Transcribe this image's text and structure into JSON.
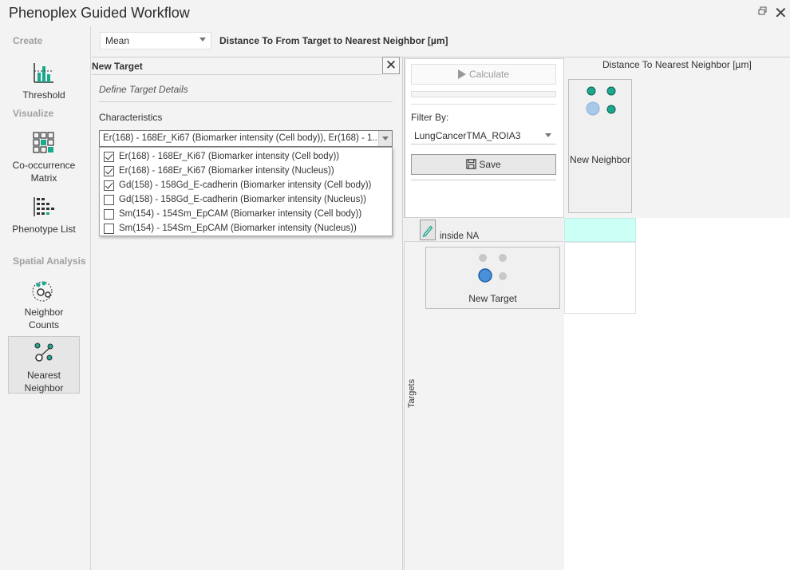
{
  "window": {
    "title": "Phenoplex Guided Workflow",
    "close_glyph": "✕"
  },
  "nav": {
    "sections": {
      "create": "Create",
      "visualize": "Visualize",
      "spatial": "Spatial Analysis"
    },
    "items": [
      {
        "label": "Threshold",
        "icon": "threshold-chart-icon"
      },
      {
        "label": "Co-occurrence Matrix",
        "icon": "matrix-grid-icon"
      },
      {
        "label": "Phenotype List",
        "icon": "phenotype-list-icon"
      },
      {
        "label": "Neighbor Counts",
        "icon": "neighbor-counts-icon"
      },
      {
        "label": "Nearest Neighbor",
        "icon": "nearest-neighbor-icon",
        "active": true
      }
    ]
  },
  "toolbar": {
    "mode": "Mean",
    "metric_title": "Distance To From Target to Nearest Neighbor [µm]"
  },
  "new_target": {
    "header": "New Target",
    "close_glyph": "✕",
    "subtitle": "Define Target Details",
    "characteristics_label": "Characteristics",
    "combo_value": "Er(168) - 168Er_Ki67 (Biomarker intensity (Cell body)), Er(168) - 1...",
    "options": [
      {
        "label": "Er(168) - 168Er_Ki67 (Biomarker intensity (Cell body))",
        "checked": true
      },
      {
        "label": "Er(168) - 168Er_Ki67 (Biomarker intensity (Nucleus))",
        "checked": true
      },
      {
        "label": "Gd(158) - 158Gd_E-cadherin (Biomarker intensity (Cell body))",
        "checked": true
      },
      {
        "label": "Gd(158) - 158Gd_E-cadherin (Biomarker intensity (Nucleus))",
        "checked": false
      },
      {
        "label": "Sm(154) - 154Sm_EpCAM (Biomarker intensity (Cell body))",
        "checked": false
      },
      {
        "label": "Sm(154) - 154Sm_EpCAM (Biomarker intensity (Nucleus))",
        "checked": false
      }
    ]
  },
  "calc": {
    "calculate_label": "Calculate",
    "filter_label": "Filter By:",
    "filter_value": "LungCancerTMA_ROIA3",
    "save_label": "Save"
  },
  "grid": {
    "column_header": "Distance To Nearest Neighbor [µm]",
    "new_neighbor": "New Neighbor",
    "row_name": "inside NA",
    "new_target": "New Target",
    "targets_axis": "Targets",
    "colors": {
      "teal": "#1aa88f",
      "target_blue": "#4a90d9",
      "light_blue": "#a9c8ea",
      "grey_dot": "#c8c8c8",
      "cell_highlight": "#ccfff6"
    }
  }
}
